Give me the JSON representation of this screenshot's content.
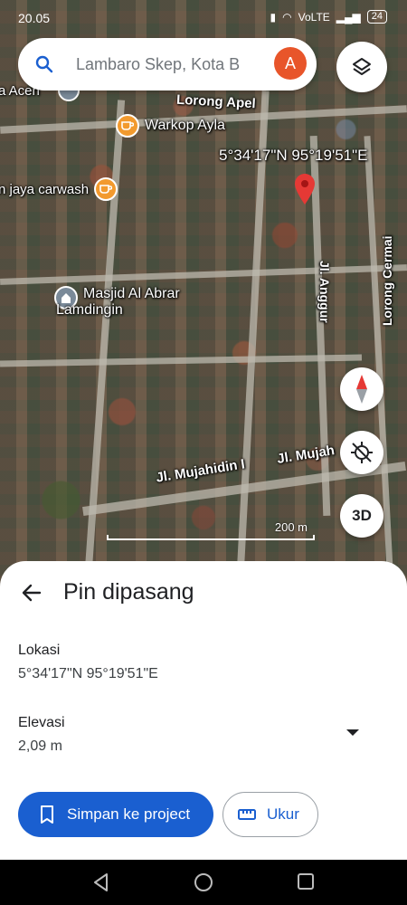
{
  "status_bar": {
    "time": "20.05",
    "network": "VoLTE",
    "battery": "24"
  },
  "search": {
    "query": "Lambaro Skep, Kota B",
    "avatar_letter": "A"
  },
  "map": {
    "coordinates": "5°34'17\"N 95°19'51\"E",
    "labels": {
      "aceh": "a Aceh",
      "lorong_apel": "Lorong Apel",
      "warkop": "Warkop Ayla",
      "carwash": "n jaya carwash",
      "masjid_line1": "Masjid Al Abrar",
      "masjid_line2": "Lamdingin",
      "jl_anggur": "Jl. Anggur",
      "lorong_cermai": "Lorong Cermai",
      "jl_mujahidin": "Jl. Mujahidin I",
      "jl_mujah": "Jl. Mujah"
    },
    "scale": "200 m",
    "btn_3d": "3D"
  },
  "sheet": {
    "title": "Pin dipasang",
    "location_label": "Lokasi",
    "location_value": "5°34'17\"N 95°19'51\"E",
    "elevation_label": "Elevasi",
    "elevation_value": "2,09 m",
    "save_button": "Simpan ke project",
    "measure_button": "Ukur"
  },
  "colors": {
    "primary": "#1a5fd0",
    "avatar": "#e8552a",
    "pin": "#e53935",
    "poi_orange": "#f29a2e"
  }
}
